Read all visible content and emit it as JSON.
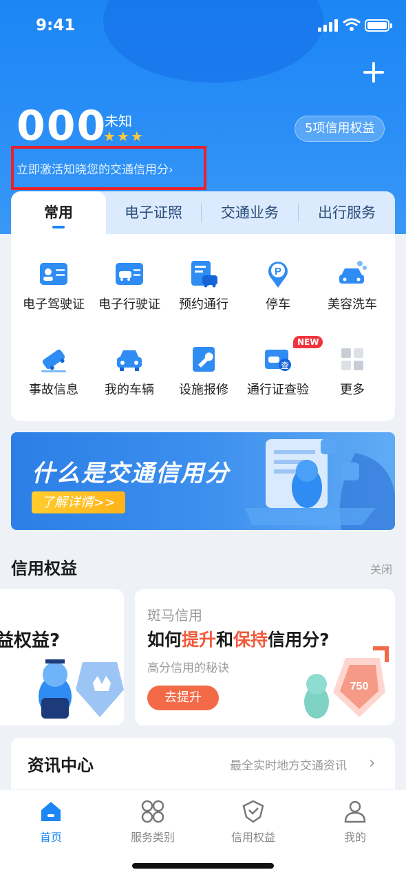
{
  "status_bar": {
    "time": "9:41"
  },
  "header": {
    "score": "000",
    "level": "未知",
    "stars": "★★★",
    "benefits_pill": "5项信用权益",
    "activate_link": "立即激活知晓您的交通信用分›"
  },
  "tabs": [
    {
      "label": "常用",
      "active": true
    },
    {
      "label": "电子证照",
      "active": false
    },
    {
      "label": "交通业务",
      "active": false
    },
    {
      "label": "出行服务",
      "active": false
    }
  ],
  "services": [
    {
      "label": "电子驾驶证",
      "icon": "driver-license-icon"
    },
    {
      "label": "电子行驶证",
      "icon": "vehicle-license-icon"
    },
    {
      "label": "预约通行",
      "icon": "reserve-pass-icon"
    },
    {
      "label": "停车",
      "icon": "parking-icon"
    },
    {
      "label": "美容洗车",
      "icon": "car-wash-icon"
    },
    {
      "label": "事故信息",
      "icon": "accident-icon"
    },
    {
      "label": "我的车辆",
      "icon": "my-car-icon"
    },
    {
      "label": "设施报修",
      "icon": "repair-icon"
    },
    {
      "label": "通行证查验",
      "icon": "pass-check-icon",
      "badge": "NEW"
    },
    {
      "label": "更多",
      "icon": "more-icon"
    }
  ],
  "banner": {
    "title": "什么是交通信用分",
    "button": "了解详情>>"
  },
  "credit_section": {
    "title": "信用权益",
    "close": "关闭",
    "left_card": {
      "partial_title": "益权益?"
    },
    "right_card": {
      "brand": "斑马信用",
      "title_parts": [
        "如何",
        "提升",
        "和",
        "保持",
        "信用分?"
      ],
      "subtitle": "高分信用的秘诀",
      "button": "去提升",
      "badge_score": "750"
    }
  },
  "news": {
    "title": "资讯中心",
    "subtitle": "最全实时地方交通资讯",
    "chevron": "›"
  },
  "bottom_nav": [
    {
      "label": "首页",
      "icon": "home-icon",
      "active": true
    },
    {
      "label": "服务类别",
      "icon": "service-category-icon",
      "active": false
    },
    {
      "label": "信用权益",
      "icon": "credit-benefit-icon",
      "active": false
    },
    {
      "label": "我的",
      "icon": "profile-icon",
      "active": false
    }
  ],
  "colors": {
    "brand_blue": "#1c86f5",
    "accent_orange": "#f05a3c",
    "highlight_red": "#e8212c"
  }
}
